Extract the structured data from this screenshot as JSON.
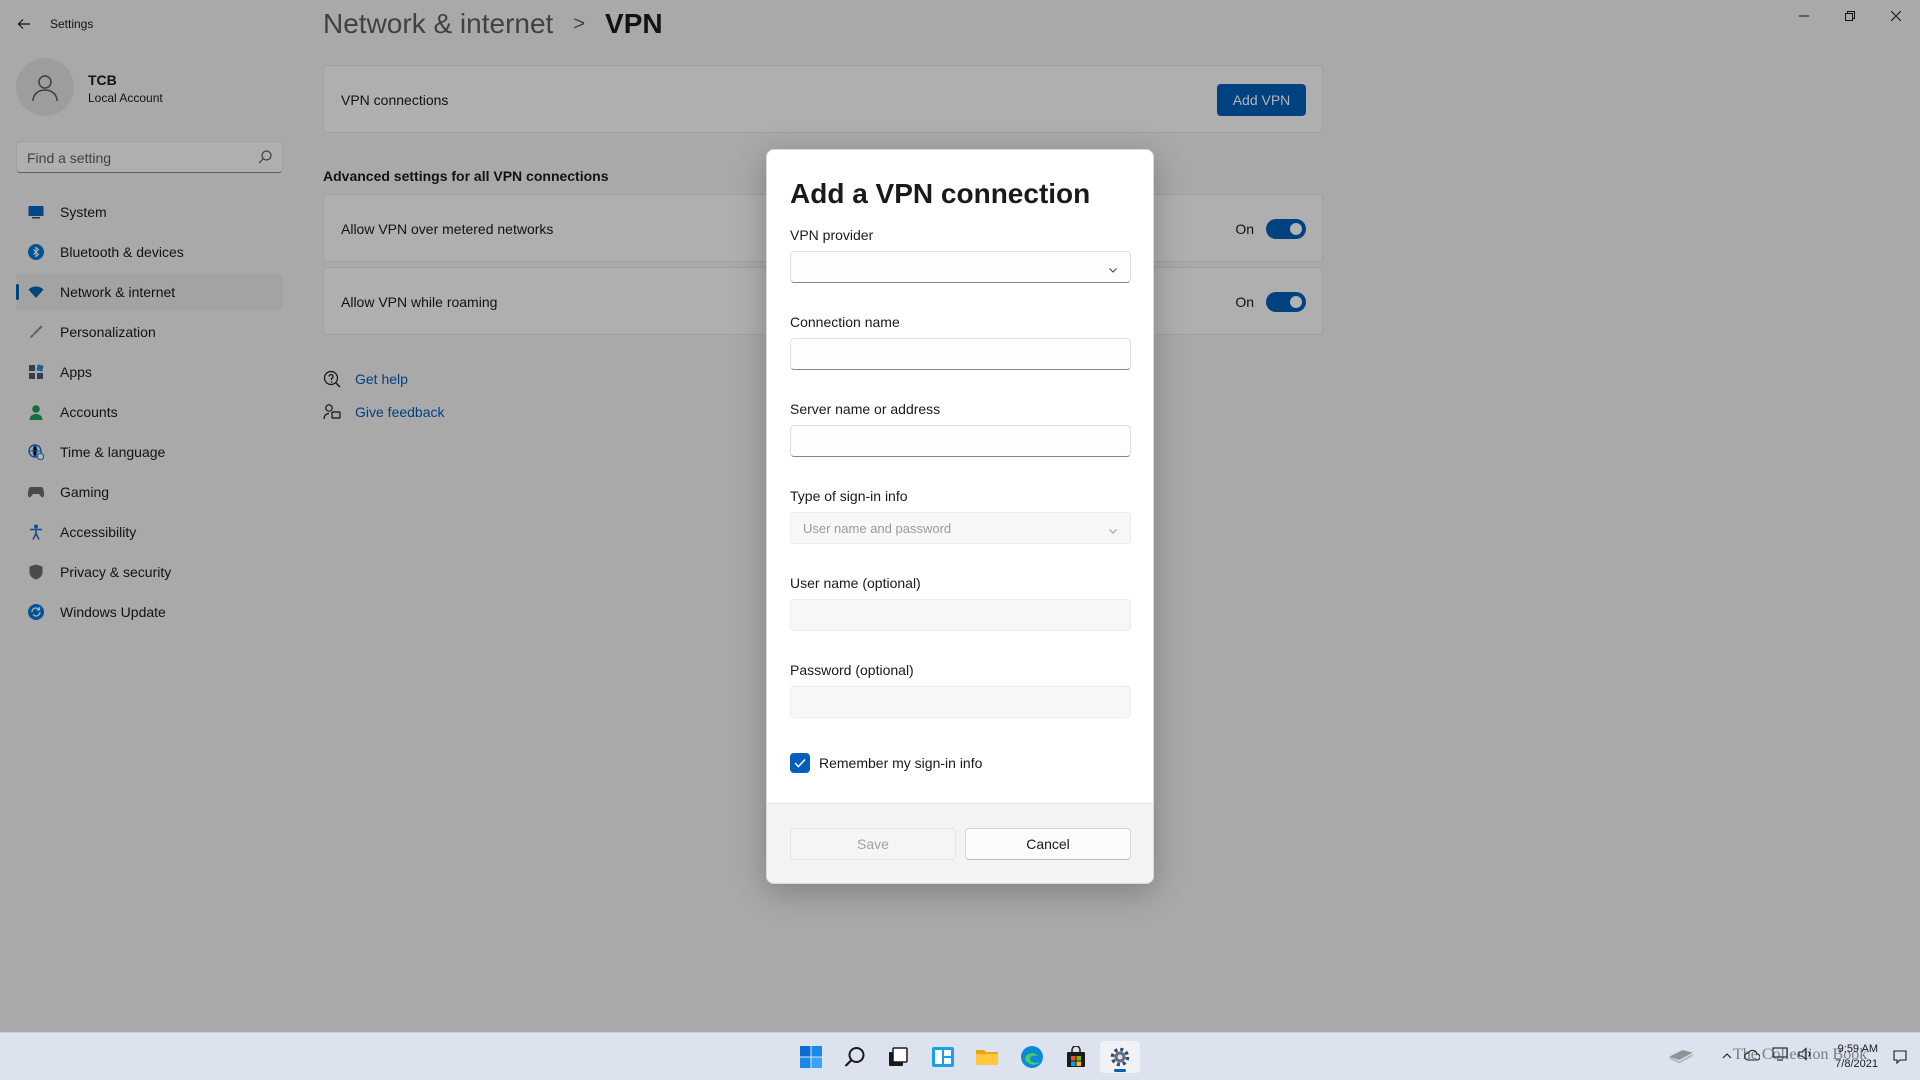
{
  "window": {
    "title": "Settings"
  },
  "profile": {
    "name": "TCB",
    "account_type": "Local Account"
  },
  "search": {
    "placeholder": "Find a setting"
  },
  "sidebar": {
    "items": [
      {
        "label": "System",
        "icon": "system-icon",
        "color": "#0067c0"
      },
      {
        "label": "Bluetooth & devices",
        "icon": "bluetooth-icon",
        "color": "#0078d4"
      },
      {
        "label": "Network & internet",
        "icon": "wifi-icon",
        "color": "#0063b1",
        "active": true
      },
      {
        "label": "Personalization",
        "icon": "brush-icon",
        "color": "#d86c2e"
      },
      {
        "label": "Apps",
        "icon": "apps-icon",
        "color": "#4c5a6e"
      },
      {
        "label": "Accounts",
        "icon": "person-icon",
        "color": "#1d9f5c"
      },
      {
        "label": "Time & language",
        "icon": "globe-clock-icon",
        "color": "#1a73d6"
      },
      {
        "label": "Gaming",
        "icon": "gamepad-icon",
        "color": "#6b6b6b"
      },
      {
        "label": "Accessibility",
        "icon": "accessibility-icon",
        "color": "#1f6fd1"
      },
      {
        "label": "Privacy & security",
        "icon": "shield-icon",
        "color": "#6c6c6c"
      },
      {
        "label": "Windows Update",
        "icon": "update-icon",
        "color": "#0078d4"
      }
    ]
  },
  "breadcrumb": {
    "parent": "Network & internet",
    "separator": ">",
    "current": "VPN"
  },
  "vpn": {
    "connections_label": "VPN connections",
    "add_button": "Add VPN",
    "advanced_heading": "Advanced settings for all VPN connections",
    "settings": [
      {
        "label": "Allow VPN over metered networks",
        "state": "On"
      },
      {
        "label": "Allow VPN while roaming",
        "state": "On"
      }
    ]
  },
  "help": {
    "get_help": "Get help",
    "give_feedback": "Give feedback"
  },
  "dialog": {
    "title": "Add a VPN connection",
    "provider_label": "VPN provider",
    "provider_value": "",
    "connection_name_label": "Connection name",
    "connection_name_value": "",
    "server_label": "Server name or address",
    "server_value": "",
    "signin_type_label": "Type of sign-in info",
    "signin_type_value": "User name and password",
    "username_label": "User name (optional)",
    "username_value": "",
    "password_label": "Password (optional)",
    "password_value": "",
    "remember_label": "Remember my sign-in info",
    "remember_checked": true,
    "save_label": "Save",
    "cancel_label": "Cancel"
  },
  "taskbar": {
    "apps": [
      "start-icon",
      "search-icon",
      "task-view-icon",
      "widgets-icon",
      "file-explorer-icon",
      "edge-icon",
      "store-icon",
      "settings-icon"
    ],
    "time": "9:59 AM",
    "date": "7/8/2021"
  },
  "watermark": {
    "text": "The Collection Book"
  },
  "colors": {
    "accent": "#005fb8",
    "background": "#f3f3f3",
    "taskbar": "#dde3ee"
  }
}
